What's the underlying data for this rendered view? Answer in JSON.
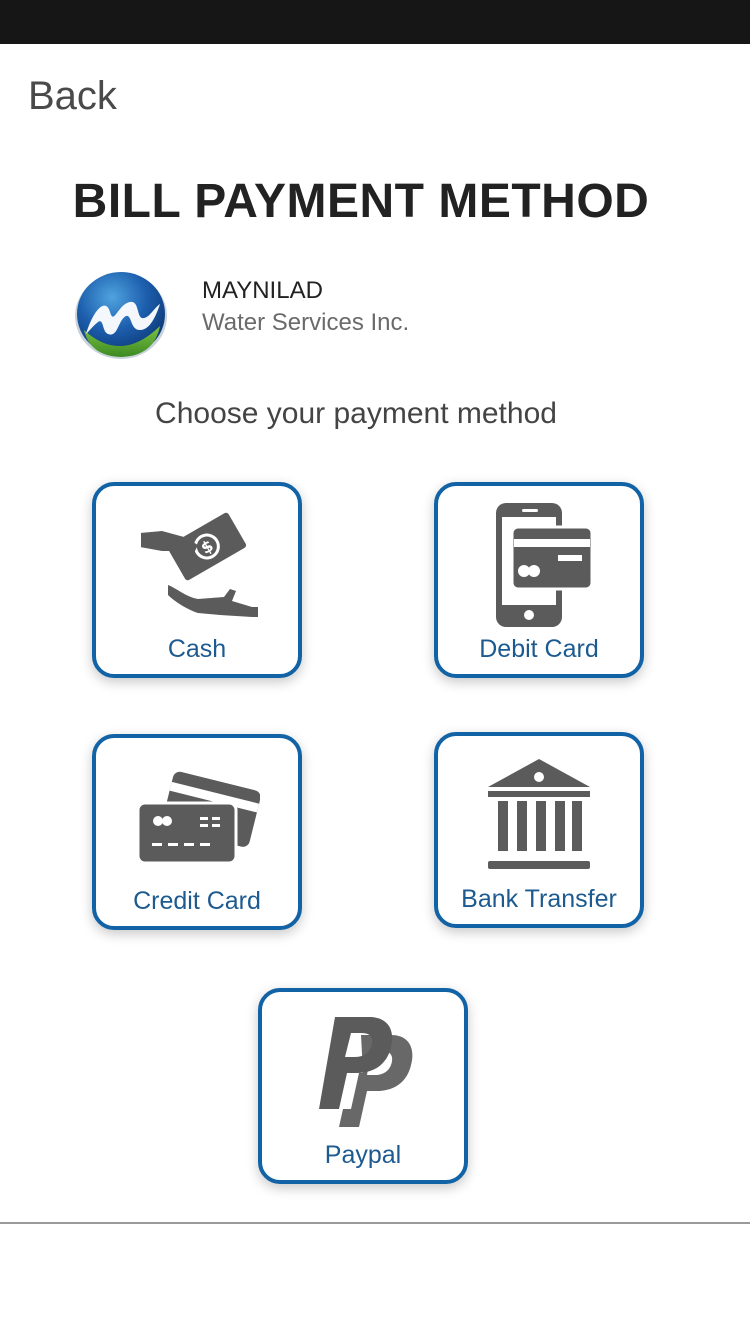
{
  "header": {
    "back_label": "Back"
  },
  "page": {
    "title": "BILL PAYMENT METHOD",
    "instruction": "Choose your payment method"
  },
  "biller": {
    "name": "MAYNILAD",
    "subtitle": "Water Services Inc.",
    "logo_icon": "maynilad-logo"
  },
  "methods": [
    {
      "label": "Cash",
      "icon": "cash-hand-icon"
    },
    {
      "label": "Debit Card",
      "icon": "mobile-card-icon"
    },
    {
      "label": "Credit Card",
      "icon": "credit-cards-icon"
    },
    {
      "label": "Bank Transfer",
      "icon": "bank-icon"
    },
    {
      "label": "Paypal",
      "icon": "paypal-icon"
    }
  ],
  "colors": {
    "accent_border": "#1263a6",
    "label_text": "#1d5a8f",
    "icon_gray": "#5b5b5b",
    "status_bar": "#161616"
  }
}
